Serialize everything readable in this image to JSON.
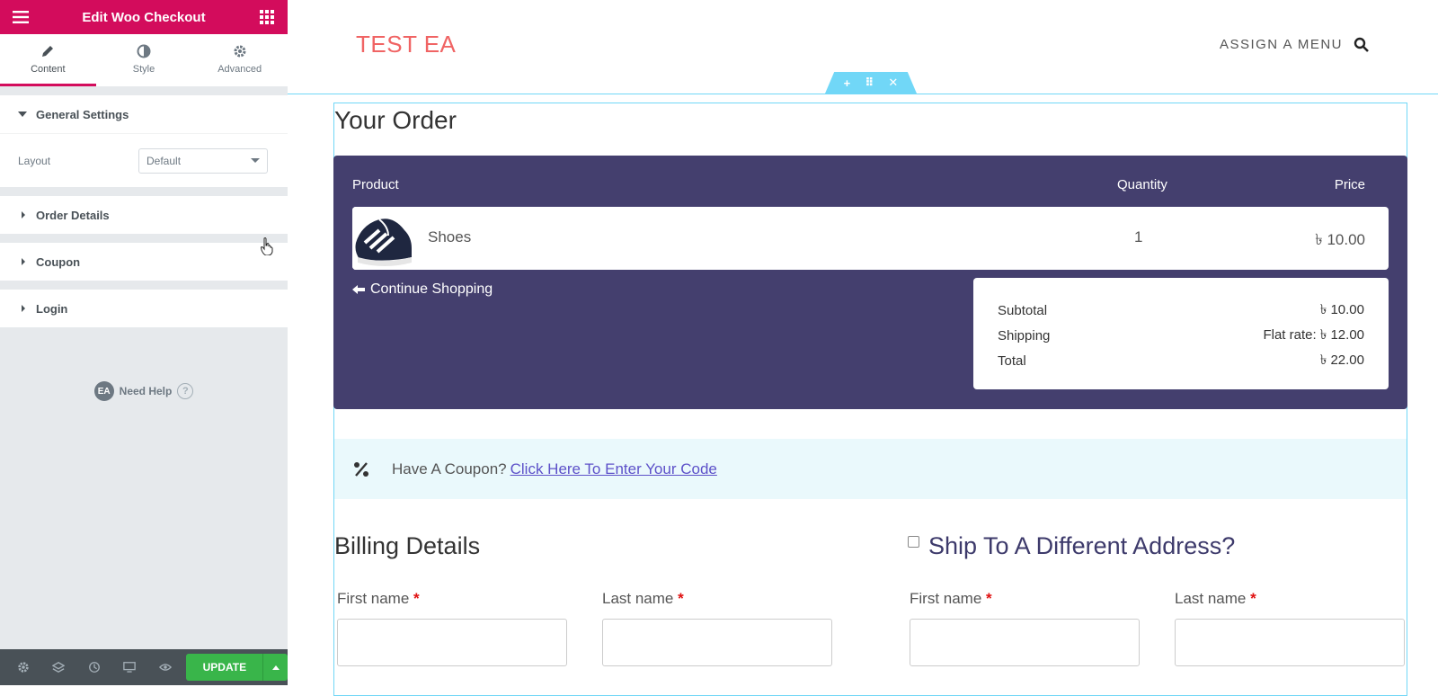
{
  "panel": {
    "title": "Edit Woo Checkout",
    "tabs": [
      {
        "label": "Content",
        "icon": "pencil-icon",
        "active": true
      },
      {
        "label": "Style",
        "icon": "half-circle-icon",
        "active": false
      },
      {
        "label": "Advanced",
        "icon": "gear-icon",
        "active": false
      }
    ],
    "sections": {
      "general": {
        "label": "General Settings",
        "expanded": true
      },
      "order": {
        "label": "Order Details"
      },
      "coupon": {
        "label": "Coupon"
      },
      "login": {
        "label": "Login"
      }
    },
    "layout_control": {
      "label": "Layout",
      "value": "Default"
    },
    "need_help": {
      "badge": "EA",
      "label": "Need Help",
      "q": "?"
    },
    "footer": {
      "update_label": "UPDATE"
    },
    "accent_color": "#d30c5c"
  },
  "site": {
    "title": "TEST EA",
    "menu": "ASSIGN A MENU"
  },
  "order": {
    "title": "Your Order",
    "headers": {
      "product": "Product",
      "quantity": "Quantity",
      "price": "Price"
    },
    "item": {
      "name": "Shoes",
      "quantity": "1",
      "price": "৳ 10.00"
    },
    "continue": "Continue Shopping",
    "totals": {
      "subtotal_label": "Subtotal",
      "subtotal": "৳ 10.00",
      "shipping_label": "Shipping",
      "shipping": "Flat rate: ৳ 12.00",
      "total_label": "Total",
      "total": "৳ 22.00"
    }
  },
  "coupon": {
    "text": "Have A Coupon?",
    "link": "Click Here To Enter Your Code"
  },
  "billing": {
    "title": "Billing Details",
    "first_name": "First name",
    "last_name": "Last name",
    "required": "*"
  },
  "shipping": {
    "title": "Ship To A Different Address?",
    "first_name": "First name",
    "last_name": "Last name",
    "required": "*"
  }
}
